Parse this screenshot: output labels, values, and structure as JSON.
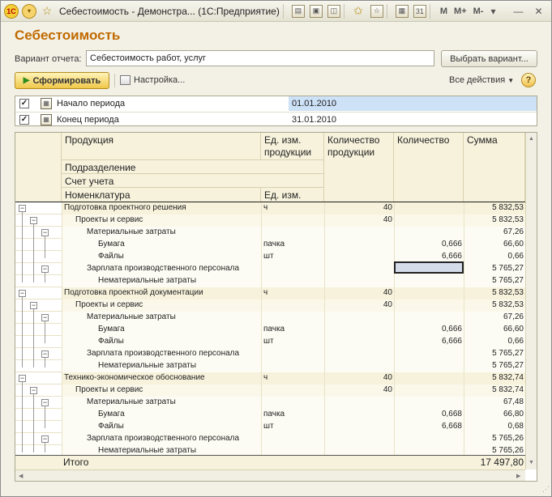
{
  "window": {
    "title": "Себестоимость - Демонстра... (1С:Предприятие)",
    "logo": "1С",
    "mem_buttons": [
      "M",
      "M+",
      "M-"
    ],
    "controls": [
      "minimize-icon",
      "close-icon"
    ]
  },
  "heading": "Себестоимость",
  "variant": {
    "label": "Вариант отчета:",
    "value": "Себестоимость работ, услуг",
    "button": "Выбрать вариант..."
  },
  "toolbar": {
    "generate": "Сформировать",
    "settings": "Настройка...",
    "all_actions": "Все действия",
    "help": "?"
  },
  "params": [
    {
      "name": "Начало периода",
      "value": "01.01.2010",
      "checked": true,
      "selected": true
    },
    {
      "name": "Конец периода",
      "value": "31.01.2010",
      "checked": true,
      "selected": false
    }
  ],
  "report": {
    "headers": {
      "product": "Продукция",
      "unit_product": "Ед. изм.\nпродукции",
      "qty_product": "Количество\nпродукции",
      "qty": "Количество",
      "sum": "Сумма",
      "department": "Подразделение",
      "account": "Счет учета",
      "nomenclature": "Номенклатура",
      "unit": "Ед. изм."
    },
    "rows": [
      {
        "level": 1,
        "name": "Подготовка проектного решения",
        "unit": "ч",
        "qp": "40",
        "q": "",
        "s": "5 832,53"
      },
      {
        "level": 2,
        "name": "Проекты и сервис",
        "unit": "",
        "qp": "40",
        "q": "",
        "s": "5 832,53"
      },
      {
        "level": 3,
        "name": "Материальные затраты",
        "unit": "",
        "qp": "",
        "q": "",
        "s": "67,26"
      },
      {
        "level": 4,
        "name": "Бумага",
        "unit": "пачка",
        "qp": "",
        "q": "0,666",
        "s": "66,60"
      },
      {
        "level": 4,
        "name": "Файлы",
        "unit": "шт",
        "qp": "",
        "q": "6,666",
        "s": "0,66"
      },
      {
        "level": 3,
        "name": "Зарплата производственного персонала",
        "unit": "",
        "qp": "",
        "q": "",
        "s": "5 765,27"
      },
      {
        "level": 4,
        "name": "Нематериальные затраты",
        "unit": "",
        "qp": "",
        "q": "",
        "s": "5 765,27"
      },
      {
        "level": 1,
        "name": "Подготовка проектной документации",
        "unit": "ч",
        "qp": "40",
        "q": "",
        "s": "5 832,53"
      },
      {
        "level": 2,
        "name": "Проекты и сервис",
        "unit": "",
        "qp": "40",
        "q": "",
        "s": "5 832,53"
      },
      {
        "level": 3,
        "name": "Материальные затраты",
        "unit": "",
        "qp": "",
        "q": "",
        "s": "67,26"
      },
      {
        "level": 4,
        "name": "Бумага",
        "unit": "пачка",
        "qp": "",
        "q": "0,666",
        "s": "66,60"
      },
      {
        "level": 4,
        "name": "Файлы",
        "unit": "шт",
        "qp": "",
        "q": "6,666",
        "s": "0,66"
      },
      {
        "level": 3,
        "name": "Зарплата производственного персонала",
        "unit": "",
        "qp": "",
        "q": "",
        "s": "5 765,27"
      },
      {
        "level": 4,
        "name": "Нематериальные затраты",
        "unit": "",
        "qp": "",
        "q": "",
        "s": "5 765,27"
      },
      {
        "level": 1,
        "name": "Технико-экономическое обоснование",
        "unit": "ч",
        "qp": "40",
        "q": "",
        "s": "5 832,74"
      },
      {
        "level": 2,
        "name": "Проекты и сервис",
        "unit": "",
        "qp": "40",
        "q": "",
        "s": "5 832,74"
      },
      {
        "level": 3,
        "name": "Материальные затраты",
        "unit": "",
        "qp": "",
        "q": "",
        "s": "67,48"
      },
      {
        "level": 4,
        "name": "Бумага",
        "unit": "пачка",
        "qp": "",
        "q": "0,668",
        "s": "66,80"
      },
      {
        "level": 4,
        "name": "Файлы",
        "unit": "шт",
        "qp": "",
        "q": "6,668",
        "s": "0,68"
      },
      {
        "level": 3,
        "name": "Зарплата производственного персонала",
        "unit": "",
        "qp": "",
        "q": "",
        "s": "5 765,26"
      },
      {
        "level": 4,
        "name": "Нематериальные затраты",
        "unit": "",
        "qp": "",
        "q": "",
        "s": "5 765,26"
      }
    ],
    "total": {
      "label": "Итого",
      "sum": "17 497,80"
    }
  }
}
